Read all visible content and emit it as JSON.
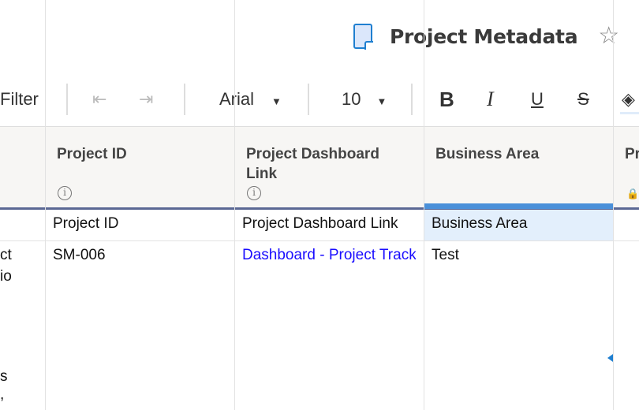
{
  "title": {
    "text": "Project Metadata",
    "doc_icon": "sheet-icon",
    "star_icon": "star-icon"
  },
  "toolbar": {
    "filter": "Filter",
    "font": "Arial",
    "size": "10",
    "bold": "B",
    "italic": "I",
    "underline": "U",
    "strike": "S"
  },
  "columns": [
    {
      "header": "Project ID",
      "info": "i"
    },
    {
      "header": "Project Dashboard Link",
      "info": "i"
    },
    {
      "header": "Business Area"
    },
    {
      "header": "Pr",
      "locked": true
    }
  ],
  "rows": [
    {
      "first": "",
      "cells": [
        "Project ID",
        "Project Dashboard Link",
        "Business Area"
      ]
    },
    {
      "first_fragments": [
        "ct",
        "io",
        "s",
        ","
      ],
      "cells": [
        "SM-006",
        "Dashboard - Project Tracker",
        "Test"
      ]
    }
  ],
  "colors": {
    "accent": "#4a90d9",
    "link": "#1a0dff",
    "selected": "#e3effc"
  }
}
